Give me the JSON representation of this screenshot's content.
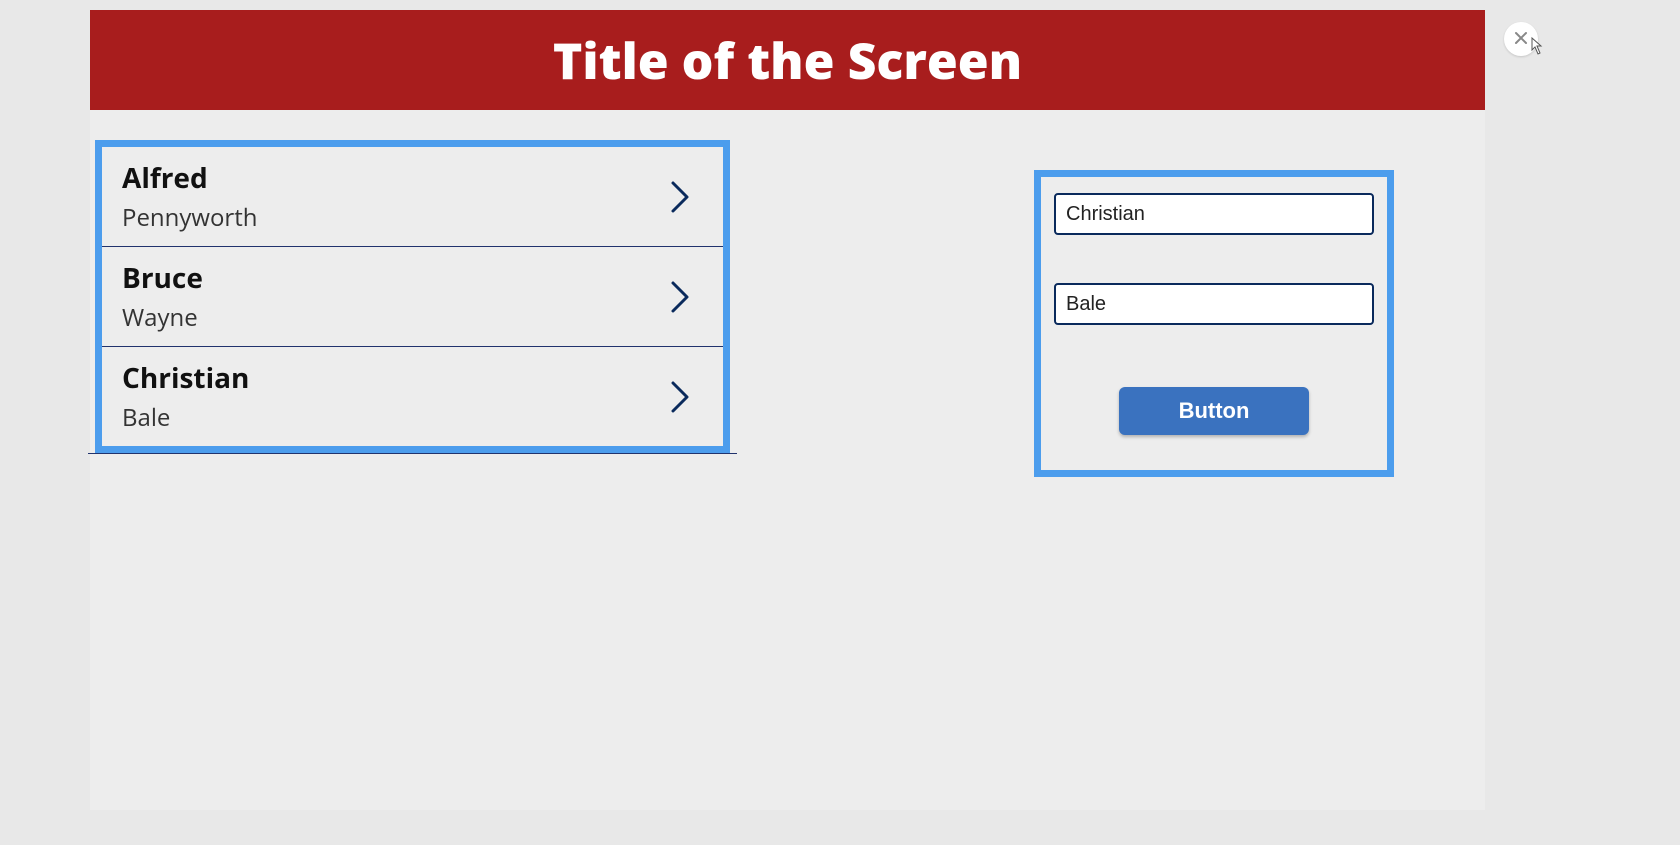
{
  "header": {
    "title": "Title of the Screen"
  },
  "list_items": [
    {
      "first": "Alfred",
      "last": "Pennyworth"
    },
    {
      "first": "Bruce",
      "last": "Wayne"
    },
    {
      "first": "Christian",
      "last": "Bale"
    }
  ],
  "form": {
    "field1_value": "Christian",
    "field2_value": "Bale",
    "button_label": "Button"
  },
  "colors": {
    "accent": "#a81d1d",
    "highlight": "#4c9ded",
    "primary_button": "#3a72bf",
    "dark_blue": "#0a2a5c"
  }
}
